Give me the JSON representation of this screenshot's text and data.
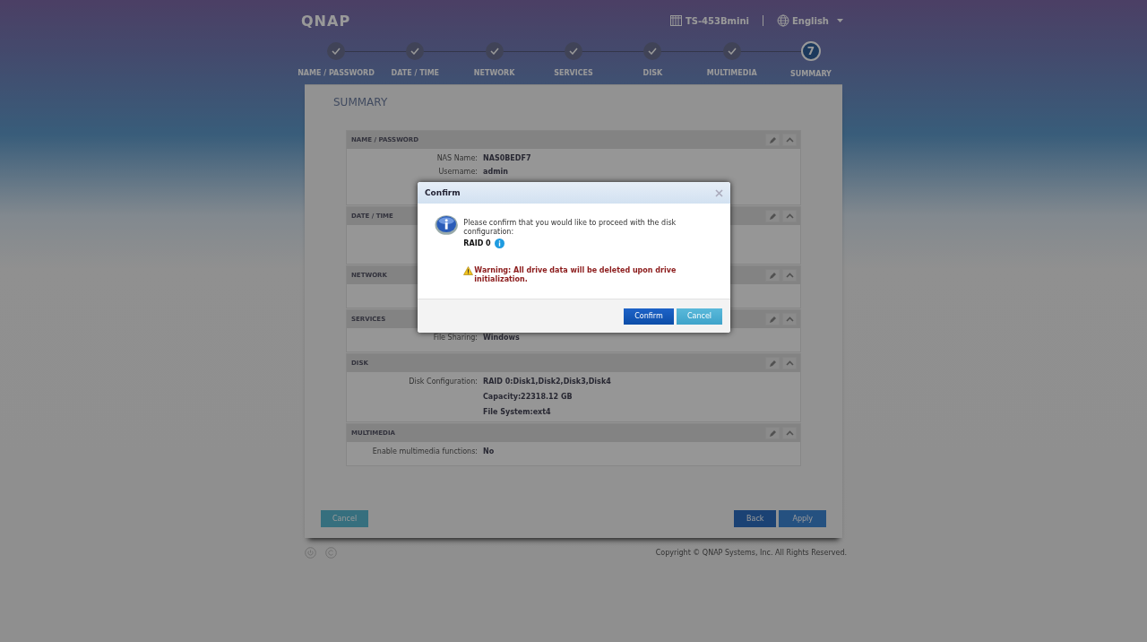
{
  "header": {
    "logo": "QNAP",
    "device": "TS-453Bmini",
    "language": "English"
  },
  "steps": [
    {
      "label": "NAME / PASSWORD",
      "done": true,
      "selected": false
    },
    {
      "label": "DATE / TIME",
      "done": true,
      "selected": false
    },
    {
      "label": "NETWORK",
      "done": true,
      "selected": false
    },
    {
      "label": "SERVICES",
      "done": true,
      "selected": false
    },
    {
      "label": "DISK",
      "done": true,
      "selected": false
    },
    {
      "label": "MULTIMEDIA",
      "done": true,
      "selected": false
    },
    {
      "label": "SUMMARY",
      "done": false,
      "selected": true,
      "number": "7"
    }
  ],
  "page_title": "SUMMARY",
  "sections": [
    {
      "title": "NAME / PASSWORD",
      "rows": [
        {
          "label": "NAS Name:",
          "values": [
            "NAS0BEDF7"
          ]
        },
        {
          "label": "Username:",
          "values": [
            "admin"
          ]
        }
      ]
    },
    {
      "title": "DATE / TIME"
    },
    {
      "title": "NETWORK"
    },
    {
      "title": "SERVICES",
      "rows": [
        {
          "label": "File Sharing:",
          "values": [
            "Windows"
          ]
        }
      ]
    },
    {
      "title": "DISK",
      "rows": [
        {
          "label": "Disk Configuration:",
          "values": [
            "RAID 0:Disk1,Disk2,Disk3,Disk4",
            "Capacity:22318.12 GB",
            "File System:ext4"
          ]
        }
      ]
    },
    {
      "title": "MULTIMEDIA",
      "rows": [
        {
          "label": "Enable multimedia functions:",
          "values": [
            "No"
          ]
        }
      ]
    }
  ],
  "buttons": {
    "cancel": "Cancel",
    "back": "Back",
    "apply": "Apply"
  },
  "copyright": "Copyright © QNAP Systems, Inc. All Rights Reserved.",
  "dialog": {
    "title": "Confirm",
    "message": "Please confirm that you would like to proceed with the disk configuration:",
    "raid": "RAID 0",
    "warning": "Warning: All drive data will be deleted upon drive initialization.",
    "confirm": "Confirm",
    "cancel": "Cancel"
  }
}
